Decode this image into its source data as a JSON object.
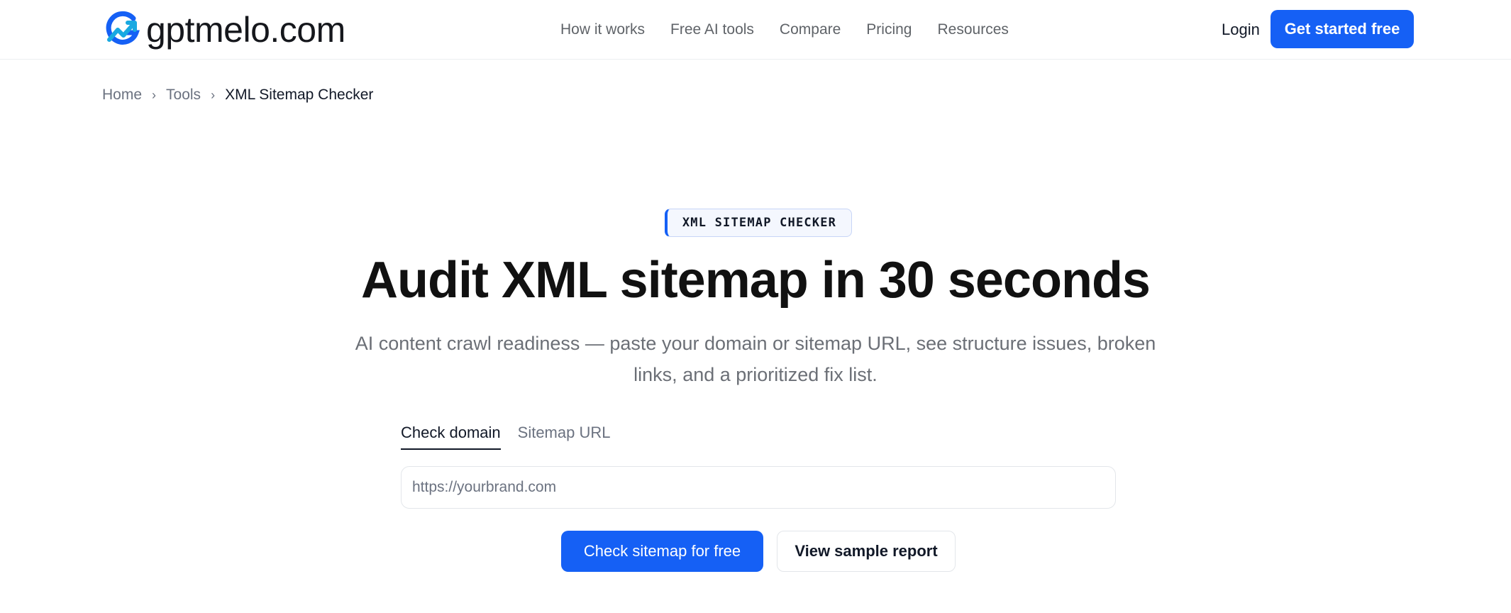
{
  "brand": {
    "name": "gptmelo.com",
    "accent": "#1560f5",
    "logo_secondary": "#19a9e1"
  },
  "nav": {
    "items": [
      {
        "label": "How it works"
      },
      {
        "label": "Free AI tools"
      },
      {
        "label": "Compare"
      },
      {
        "label": "Pricing"
      },
      {
        "label": "Resources"
      }
    ],
    "login": "Login",
    "cta": "Get started free"
  },
  "breadcrumb": {
    "items": [
      "Home",
      "Tools",
      "XML Sitemap Checker"
    ],
    "separator_icon": "chevron-right-icon"
  },
  "hero": {
    "badge": "XML SITEMAP CHECKER",
    "title": "Audit XML sitemap in 30 seconds",
    "subtitle": "AI content crawl readiness — paste your domain or sitemap URL, see structure issues, broken links, and a prioritized fix list."
  },
  "form": {
    "tabs": [
      {
        "label": "Check domain",
        "active": true
      },
      {
        "label": "Sitemap URL",
        "active": false
      }
    ],
    "input": {
      "value": "",
      "placeholder": "https://yourbrand.com"
    },
    "primary_button": "Check sitemap for free",
    "secondary_button": "View sample report"
  }
}
